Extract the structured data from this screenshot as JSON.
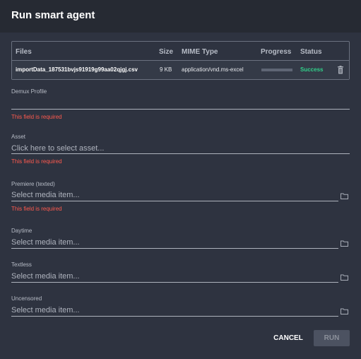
{
  "dialog": {
    "title": "Run smart agent"
  },
  "table": {
    "headers": {
      "files": "Files",
      "size": "Size",
      "mime": "MIME Type",
      "progress": "Progress",
      "status": "Status"
    },
    "rows": [
      {
        "file": "importData_187531bvjs91919g99aa02qjgj.csv",
        "size": "9 KB",
        "mime": "application/vnd.ms-excel",
        "progress": 1.0,
        "status": "Success"
      }
    ]
  },
  "fields": {
    "demux": {
      "label": "Demux Profile",
      "value": "",
      "error": "This field is required"
    },
    "asset": {
      "label": "Asset",
      "placeholder": "Click here to select asset...",
      "error": "This field is required"
    },
    "premiere": {
      "label": "Premiere (texted)",
      "placeholder": "Select media item...",
      "error": "This field is required"
    },
    "daytime": {
      "label": "Daytime",
      "placeholder": "Select media item..."
    },
    "textless": {
      "label": "Textless",
      "placeholder": "Select media item..."
    },
    "uncensored": {
      "label": "Uncensored",
      "placeholder": "Select media item..."
    }
  },
  "actions": {
    "cancel": "CANCEL",
    "run": "RUN"
  },
  "colors": {
    "success": "#31d08a",
    "error": "#ff5a4e",
    "background": "#2e3340",
    "header": "#262a33"
  },
  "icons": {
    "delete": "trash-icon",
    "browse": "folder-icon"
  }
}
